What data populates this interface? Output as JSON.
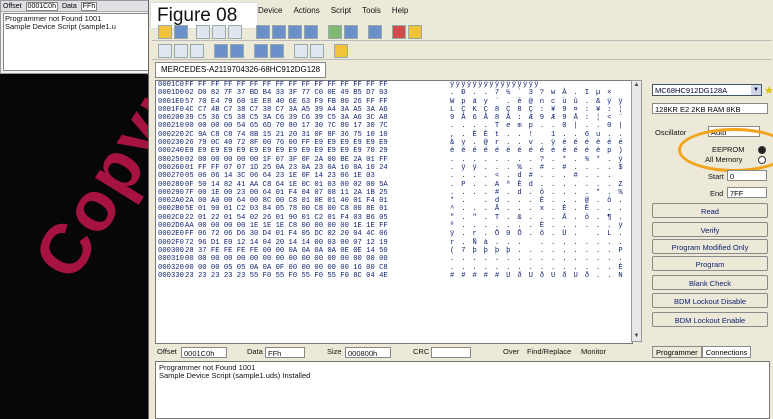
{
  "figure_label": "Figure 08",
  "watermark": "Copyright",
  "thumb": {
    "offset_label": "Offset",
    "offset_value": "0001C0h",
    "data_label": "Data",
    "data_value": "FFh",
    "log_lines": [
      "Programmer not Found 1001",
      "Sample Device Script (sample1.u"
    ]
  },
  "menu": [
    "Device",
    "Actions",
    "Script",
    "Tools",
    "Help"
  ],
  "device_tab": "MERCEDES-A2119704326-68HC912DG128",
  "hex_rows": [
    {
      "addr": "0001C0",
      "bytes": "FF FF FF FF FF FF FF FF FF FF FF FF FF FF FF FF",
      "ascii": "ÿÿÿÿÿÿÿÿÿÿÿÿÿÿÿÿ"
    },
    {
      "addr": "0001D0",
      "bytes": "02 D0 82 7F 37 BD B4 33 3F 77 C0 0E 49 B5 D7 03",
      "ascii": ". Ð . . 7 ½ ´ 3 ? w À . I µ ×"
    },
    {
      "addr": "0001E0",
      "bytes": "57 70 E4 79 60 1E E8 40 6E 63 F9 FB 80 26 FF FF",
      "ascii": "W p ä y ` . è @ n c ù û . & ÿ ÿ"
    },
    {
      "addr": "0001F0",
      "bytes": "4C C7 4B C7 38 C7 38 C7 3A A5 39 A4 3A A5 3A A6",
      "ascii": "L Ç K Ç 8 Ç 8 Ç : ¥ 9 ¤ : ¥ : ¦"
    },
    {
      "addr": "000200",
      "bytes": "39 C5 36 C5 38 C5 3A C6 39 C6 39 C5 3A A6 3C A8",
      "ascii": "9 Å 6 Å 8 Å : Æ 9 Æ 9 Å : ¦ < ¨"
    },
    {
      "addr": "000210",
      "bytes": "00 00 00 00 54 65 6D 70 80 17 30 7C 80 17 30 7C",
      "ascii": ". . . . T e m p . . 0 | . . 0 |"
    },
    {
      "addr": "000220",
      "bytes": "2C 9A C8 C8 74 8B 15 21 20 31 0F 8F 36 75 10 10",
      "ascii": ", . È È t . . !   1 . . 6 u . ."
    },
    {
      "addr": "000230",
      "bytes": "26 79 0C 40 72 8F 00 76 00 FF E9 E9 E9 E9 E9 E9",
      "ascii": "& y . @ r . . v . ÿ é é é é é é"
    },
    {
      "addr": "000240",
      "bytes": "E9 E9 E9 E9 E9 E9 E9 E9 E9 E9 E9 E9 E9 E9 70 29",
      "ascii": "é é é é é é é é é é é é é é p )"
    },
    {
      "addr": "000250",
      "bytes": "02 00 00 00 00 00 1F 07 3F 0F 2A 00 BE 2A 01 FF",
      "ascii": ". . . . . . . . ? . * . ¾ * . ÿ"
    },
    {
      "addr": "000260",
      "bytes": "01 FF FF 07 07 1D 25 0A 23 0A 23 0A 10 0A 10 24",
      "ascii": ". ÿ ÿ . . . % . # . # . . . . $"
    },
    {
      "addr": "000270",
      "bytes": "05 06 06 14 3C 06 64 23 1E 0F 14 23 06 1E 03",
      "ascii": ". . . . < . d # . . . # . . ."
    },
    {
      "addr": "000280",
      "bytes": "0F 50 14 82 41 AA C8 64 1E 0C 01 03 00 02 00 5A",
      "ascii": ". P . . A ª È d . . . . . . . Z"
    },
    {
      "addr": "000290",
      "bytes": "7F 00 1E 00 23 00 64 01 F4 04 07 08 11 2A 1B 25",
      "ascii": ". . . . # . d . ô . . . . * . %"
    },
    {
      "addr": "0002A0",
      "bytes": "2A 00 A0 00 64 00 8C 00 C8 01 0E 01 40 01 F4 01",
      "ascii": "* .   . d . . . È . . . @ . ô ."
    },
    {
      "addr": "0002B0",
      "bytes": "5E 01 90 01 C2 03 84 05 78 00 C8 00 C8 00 8E 01",
      "ascii": "^ . . . Â . . . x . È . È . . ."
    },
    {
      "addr": "0002C0",
      "bytes": "22 01 22 01 54 02 26 01 90 01 C2 01 F4 03 B6 05",
      "ascii": "\" . \" . T . & . . . Â . ô . ¶ ."
    },
    {
      "addr": "0002D0",
      "bytes": "AA 00 00 00 00 1E 1E 1E C8 00 00 00 00 1E 1E FF",
      "ascii": "ª . . . . . . . È . . . . . . ÿ"
    },
    {
      "addr": "0002E0",
      "bytes": "FF 06 72 06 D6 30 D4 01 F4 05 DC 02 20 04 4C 06",
      "ascii": "ÿ . r . Ö 0 Ô . ô . Ü .   . L ."
    },
    {
      "addr": "0002F0",
      "bytes": "72 96 D1 E0 12 14 04 20 14 14 00 03 00 07 12 19",
      "ascii": "r . Ñ à . . .   . . . . . . . ."
    },
    {
      "addr": "000300",
      "bytes": "28 37 FE FE FE FE 00 00 0A 0A 0A 0A 0E 0E 14 50",
      "ascii": "( 7 þ þ þ þ . . . . . . . . . P"
    },
    {
      "addr": "000310",
      "bytes": "00 00 00 00 00 00 00 00 00 00 00 00 00 00 00 00",
      "ascii": ". . . . . . . . . . . . . . . ."
    },
    {
      "addr": "000320",
      "bytes": "00 00 00 05 05 0A 0A 0F 00 00 00 00 00 16 00 C8",
      "ascii": ". . . . . . . . . . . . . . . È"
    },
    {
      "addr": "000330",
      "bytes": "23 23 23 23 23 55 F0 55 F0 55 F0 55 F0 8C 04 4E",
      "ascii": "# # # # # U ð U ð U ð U ð . . N"
    }
  ],
  "right_panel": {
    "device_select": "MC68HC912DG128A",
    "memory_info": "128KR E2 2KB RAM 8KB",
    "oscillator_label": "Oscillator",
    "oscillator_value": "Auto",
    "eeprom_label": "EEPROM",
    "all_memory_label": "All Memory",
    "start_label": "Start",
    "start_value": "0",
    "end_label": "End",
    "end_value": "7FF",
    "buttons": [
      "Read",
      "Verify",
      "Program Modified Only",
      "Program",
      "Blank Check",
      "BDM Lockout Disable",
      "BDM Lockout Enable"
    ]
  },
  "status": {
    "offset_label": "Offset",
    "offset_value": "0001C0h",
    "data_label": "Data",
    "data_value": "FFh",
    "size_label": "Size",
    "size_value": "000800h",
    "crc_label": "CRC",
    "mode": "Over",
    "find_replace": "Find/Replace",
    "monitor": "Monitor"
  },
  "tabs": [
    "Programmer",
    "Connections"
  ],
  "log_lines": [
    "Programmer not Found 1001",
    "Sample Device Script (sample1.uds) Installed"
  ],
  "colors": {
    "highlight_ellipse": "#f2a31a",
    "watermark": "#c4164b",
    "hex_text": "#0c1f6b"
  }
}
